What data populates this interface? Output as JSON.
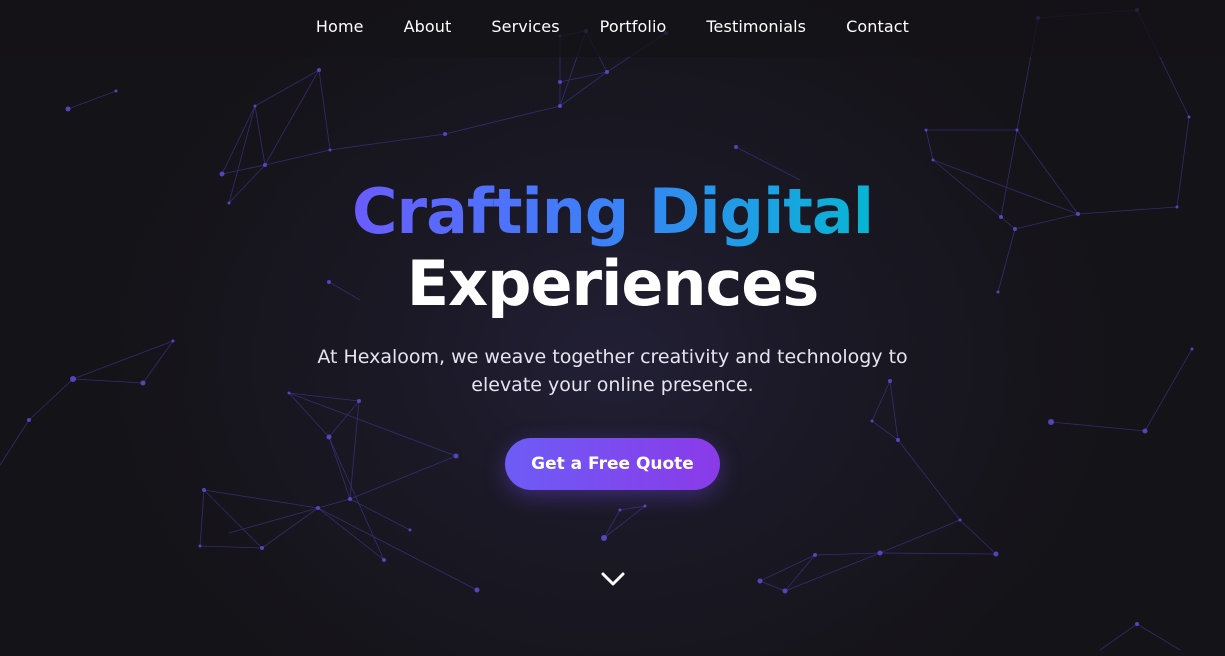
{
  "nav": {
    "items": [
      {
        "label": "Home"
      },
      {
        "label": "About"
      },
      {
        "label": "Services"
      },
      {
        "label": "Portfolio"
      },
      {
        "label": "Testimonials"
      },
      {
        "label": "Contact"
      }
    ]
  },
  "hero": {
    "title_line1": "Crafting Digital",
    "title_line2": "Experiences",
    "subtitle": "At Hexaloom, we weave together creativity and technology to elevate your online presence.",
    "cta_label": "Get a Free Quote",
    "scroll_icon": "chevron-down-icon"
  },
  "colors": {
    "background": "#141317",
    "accent_start": "#6d5cf6",
    "accent_end": "#8b3ae8",
    "title_gradient_start": "#6a5cff",
    "title_gradient_end": "#06b6d4",
    "network_line": "#4b3fb0"
  }
}
